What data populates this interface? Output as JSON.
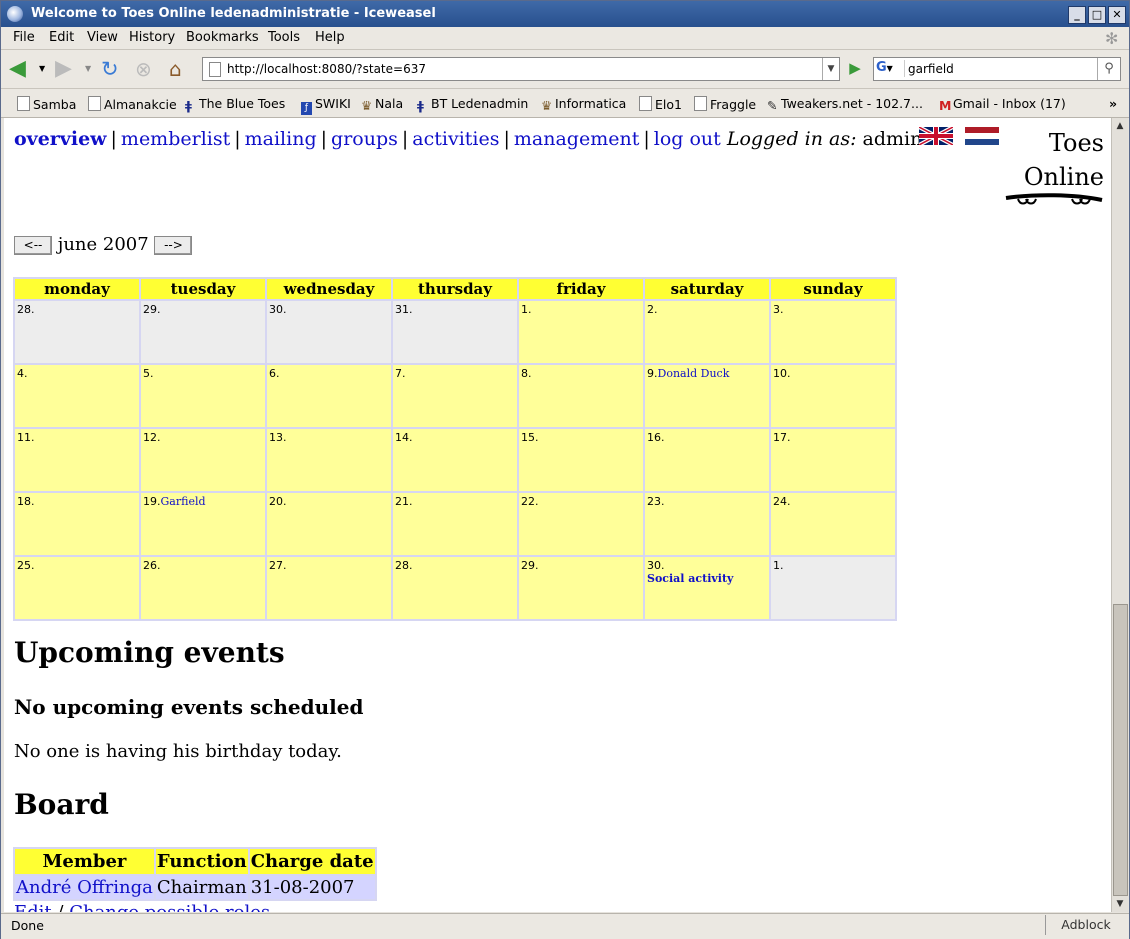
{
  "window": {
    "title": "Welcome to Toes Online ledenadministratie - Iceweasel"
  },
  "menu": [
    "File",
    "Edit",
    "View",
    "History",
    "Bookmarks",
    "Tools",
    "Help"
  ],
  "url": "http://localhost:8080/?state=637",
  "search": {
    "value": "garfield"
  },
  "bookmarks": [
    "Samba",
    "Almanakcie",
    "The Blue Toes",
    "SWIKI",
    "Nala",
    "BT Ledenadmin",
    "Informatica",
    "Elo1",
    "Fraggle",
    "Tweakers.net - 102.7...",
    "Gmail - Inbox (17)"
  ],
  "nav": {
    "overview": "overview",
    "memberlist": "memberlist",
    "mailing": "mailing",
    "groups": "groups",
    "activities": "activities",
    "management": "management",
    "logout": "log out",
    "logged_label": "Logged in as:",
    "user": "admin"
  },
  "logo": {
    "line1": "Toes",
    "line2": "Online"
  },
  "calendar": {
    "prev": "<--",
    "next": "-->",
    "month": "june 2007",
    "days": [
      "monday",
      "tuesday",
      "wednesday",
      "thursday",
      "friday",
      "saturday",
      "sunday"
    ],
    "weeks": [
      [
        {
          "d": "28.",
          "o": true
        },
        {
          "d": "29.",
          "o": true
        },
        {
          "d": "30.",
          "o": true
        },
        {
          "d": "31.",
          "o": true
        },
        {
          "d": "1."
        },
        {
          "d": "2."
        },
        {
          "d": "3."
        }
      ],
      [
        {
          "d": "4."
        },
        {
          "d": "5."
        },
        {
          "d": "6."
        },
        {
          "d": "7."
        },
        {
          "d": "8."
        },
        {
          "d": "9.",
          "e": "Donald Duck"
        },
        {
          "d": "10."
        }
      ],
      [
        {
          "d": "11."
        },
        {
          "d": "12."
        },
        {
          "d": "13."
        },
        {
          "d": "14."
        },
        {
          "d": "15."
        },
        {
          "d": "16."
        },
        {
          "d": "17."
        }
      ],
      [
        {
          "d": "18."
        },
        {
          "d": "19.",
          "e": "Garfield"
        },
        {
          "d": "20."
        },
        {
          "d": "21."
        },
        {
          "d": "22."
        },
        {
          "d": "23."
        },
        {
          "d": "24."
        }
      ],
      [
        {
          "d": "25."
        },
        {
          "d": "26."
        },
        {
          "d": "27."
        },
        {
          "d": "28."
        },
        {
          "d": "29."
        },
        {
          "d": "30.",
          "a": "Social activity"
        },
        {
          "d": "1.",
          "o": true
        }
      ]
    ]
  },
  "upcoming": {
    "heading": "Upcoming events",
    "none": "No upcoming events scheduled",
    "birthday": "No one is having his birthday today."
  },
  "board": {
    "heading": "Board",
    "headers": [
      "Member",
      "Function",
      "Charge date"
    ],
    "rows": [
      {
        "member": "André Offringa",
        "function": "Chairman",
        "date": "31-08-2007"
      }
    ],
    "edit": "Edit",
    "slash": "/",
    "change": "Change possible roles"
  },
  "status": {
    "text": "Done",
    "adblock": "Adblock"
  }
}
